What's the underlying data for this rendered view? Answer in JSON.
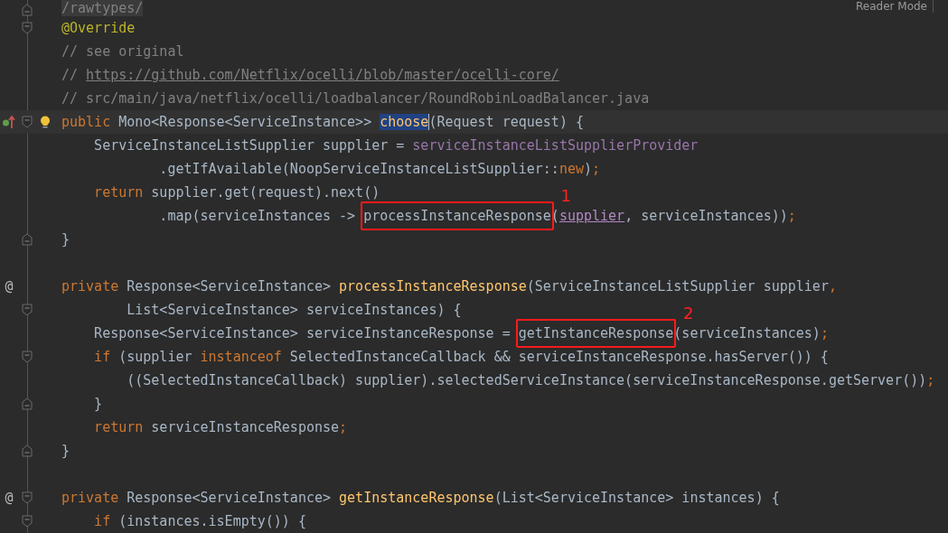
{
  "reader_mode": "Reader Mode",
  "lines": [
    {
      "kind": "code",
      "gutter": [
        {
          "kind": "fold_end"
        }
      ],
      "tokens": [
        {
          "text": "/rawtypes/",
          "kind": "comment_hl"
        }
      ]
    },
    {
      "kind": "code",
      "gutter": [
        {
          "kind": "fold_start"
        }
      ],
      "tokens": [
        {
          "text": "@Override",
          "kind": "annotation"
        }
      ]
    },
    {
      "kind": "code",
      "tokens": [
        {
          "text": "// see original",
          "kind": "comment"
        }
      ]
    },
    {
      "kind": "code",
      "tokens": [
        {
          "text": "// ",
          "kind": "comment"
        },
        {
          "text": "https://github.com/Netflix/ocelli/blob/master/ocelli-core/",
          "kind": "link"
        }
      ]
    },
    {
      "kind": "code",
      "tokens": [
        {
          "text": "// src/main/java/netflix/ocelli/loadbalancer/RoundRobinLoadBalancer.java",
          "kind": "comment"
        }
      ]
    },
    {
      "kind": "code",
      "current": true,
      "gutter": [
        {
          "kind": "override"
        },
        {
          "kind": "fold_start"
        },
        {
          "kind": "bulb"
        }
      ],
      "tokens": [
        {
          "text": "public",
          "kind": "keyword"
        },
        {
          "text": " Mono<Response<ServiceInstance>> ",
          "kind": "plain"
        },
        {
          "text": "choose",
          "kind": "selected"
        },
        {
          "text": "(Request request) {",
          "kind": "plain"
        }
      ]
    },
    {
      "kind": "code",
      "tokens": [
        {
          "text": "    ServiceInstanceListSupplier supplier = ",
          "kind": "plain"
        },
        {
          "text": "serviceInstanceListSupplierProvider",
          "kind": "field"
        }
      ]
    },
    {
      "kind": "code",
      "tokens": [
        {
          "text": "            .getIfAvailable(NoopServiceInstanceListSupplier::",
          "kind": "plain"
        },
        {
          "text": "new",
          "kind": "keyword"
        },
        {
          "text": ")",
          "kind": "plain"
        },
        {
          "text": ";",
          "kind": "keyword"
        }
      ]
    },
    {
      "kind": "code",
      "tokens": [
        {
          "text": "    return",
          "kind": "keyword"
        },
        {
          "text": " supplier.get(request).next()",
          "kind": "plain"
        }
      ]
    },
    {
      "kind": "code",
      "tokens": [
        {
          "text": "            .map(serviceInstances -> ",
          "kind": "plain"
        },
        {
          "text": "processInstanceResponse",
          "kind": "plain",
          "callout": "1"
        },
        {
          "text": "(",
          "kind": "plain"
        },
        {
          "text": "supplier",
          "kind": "param"
        },
        {
          "text": ", serviceInstances))",
          "kind": "plain"
        },
        {
          "text": ";",
          "kind": "keyword"
        }
      ]
    },
    {
      "kind": "code",
      "gutter": [
        {
          "kind": "fold_end"
        }
      ],
      "tokens": [
        {
          "text": "}",
          "kind": "plain"
        }
      ]
    },
    {
      "kind": "blank"
    },
    {
      "kind": "code",
      "gutter": [
        {
          "kind": "implementation",
          "text": "@"
        }
      ],
      "tokens": [
        {
          "text": "private",
          "kind": "keyword"
        },
        {
          "text": " Response<ServiceInstance> ",
          "kind": "plain"
        },
        {
          "text": "processInstanceResponse",
          "kind": "method"
        },
        {
          "text": "(ServiceInstanceListSupplier supplier",
          "kind": "plain"
        },
        {
          "text": ",",
          "kind": "keyword"
        }
      ]
    },
    {
      "kind": "code",
      "gutter": [
        {
          "kind": "fold_start"
        }
      ],
      "tokens": [
        {
          "text": "        List<ServiceInstance> serviceInstances) {",
          "kind": "plain"
        }
      ]
    },
    {
      "kind": "code",
      "tokens": [
        {
          "text": "    Response<ServiceInstance> serviceInstanceResponse = ",
          "kind": "plain"
        },
        {
          "text": "getInstanceResponse",
          "kind": "plain",
          "callout": "2"
        },
        {
          "text": "(serviceInstances)",
          "kind": "plain"
        },
        {
          "text": ";",
          "kind": "keyword"
        }
      ]
    },
    {
      "kind": "code",
      "gutter": [
        {
          "kind": "fold_start"
        }
      ],
      "tokens": [
        {
          "text": "    if",
          "kind": "keyword"
        },
        {
          "text": " (supplier ",
          "kind": "plain"
        },
        {
          "text": "instanceof",
          "kind": "keyword"
        },
        {
          "text": " SelectedInstanceCallback && serviceInstanceResponse.hasServer()) {",
          "kind": "plain"
        }
      ]
    },
    {
      "kind": "code",
      "tokens": [
        {
          "text": "        ((SelectedInstanceCallback) supplier).selectedServiceInstance(serviceInstanceResponse.getServer())",
          "kind": "plain"
        },
        {
          "text": ";",
          "kind": "keyword"
        }
      ]
    },
    {
      "kind": "code",
      "gutter": [
        {
          "kind": "fold_end"
        }
      ],
      "tokens": [
        {
          "text": "    }",
          "kind": "plain"
        }
      ]
    },
    {
      "kind": "code",
      "tokens": [
        {
          "text": "    return",
          "kind": "keyword"
        },
        {
          "text": " serviceInstanceResponse",
          "kind": "plain"
        },
        {
          "text": ";",
          "kind": "keyword"
        }
      ]
    },
    {
      "kind": "code",
      "gutter": [
        {
          "kind": "fold_end"
        }
      ],
      "tokens": [
        {
          "text": "}",
          "kind": "plain"
        }
      ]
    },
    {
      "kind": "blank"
    },
    {
      "kind": "code",
      "gutter": [
        {
          "kind": "implementation",
          "text": "@"
        },
        {
          "kind": "fold_start"
        }
      ],
      "tokens": [
        {
          "text": "private",
          "kind": "keyword"
        },
        {
          "text": " Response<ServiceInstance> ",
          "kind": "plain"
        },
        {
          "text": "getInstanceResponse",
          "kind": "method"
        },
        {
          "text": "(List<ServiceInstance> instances) {",
          "kind": "plain"
        }
      ]
    },
    {
      "kind": "code",
      "gutter": [
        {
          "kind": "fold_start"
        }
      ],
      "tokens": [
        {
          "text": "    if",
          "kind": "keyword"
        },
        {
          "text": " (instances.isEmpty()) {",
          "kind": "plain"
        }
      ]
    }
  ]
}
